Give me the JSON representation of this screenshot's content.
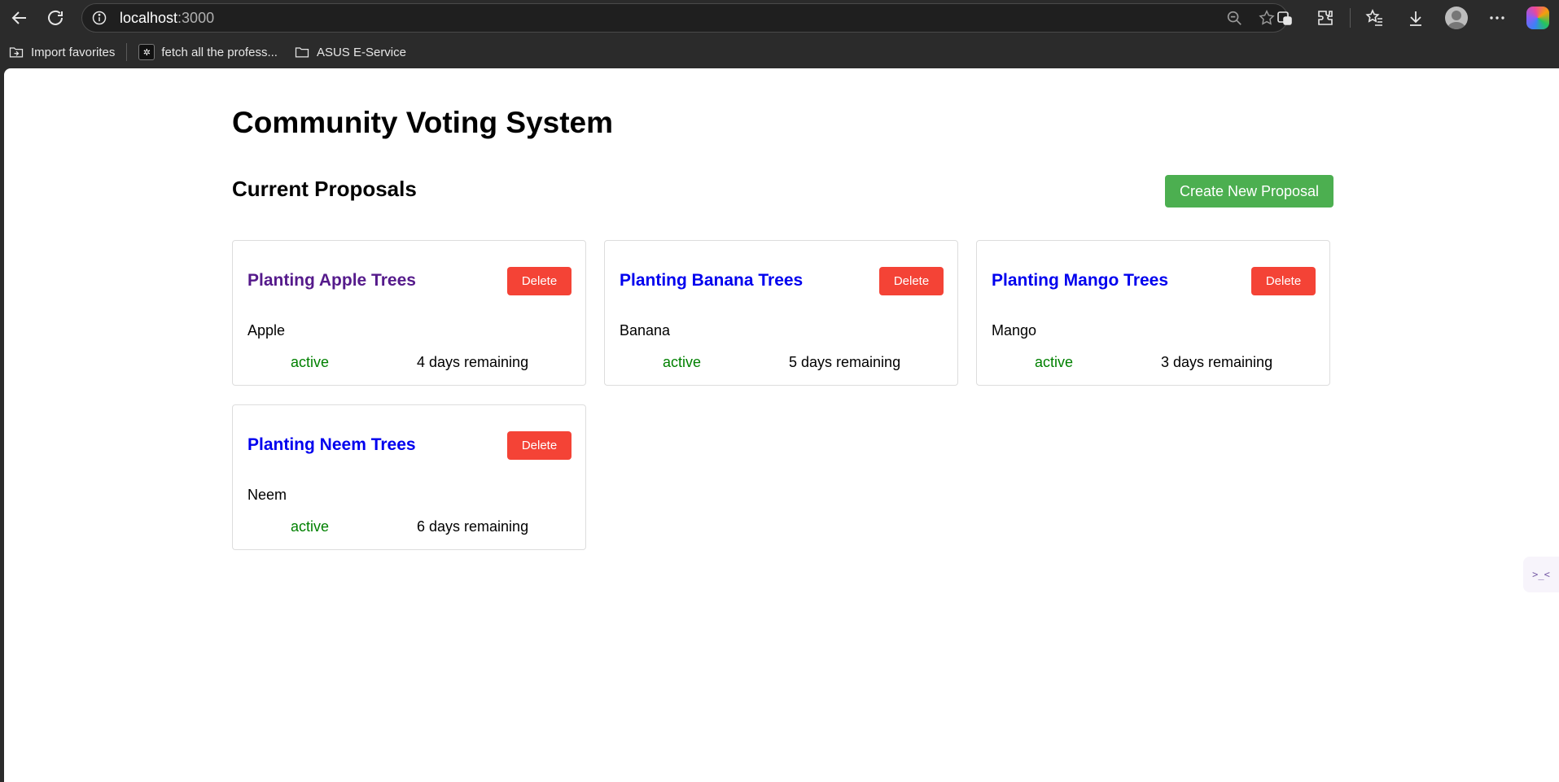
{
  "browser": {
    "url_host": "localhost",
    "url_port": ":3000",
    "bookmarks": [
      {
        "label": "Import favorites",
        "icon": "import-folder-icon"
      },
      {
        "label": "fetch all the profess...",
        "icon": "site-logo-icon"
      },
      {
        "label": "ASUS E-Service",
        "icon": "folder-icon"
      }
    ]
  },
  "page": {
    "title": "Community Voting System",
    "section_title": "Current Proposals",
    "create_button": "Create New Proposal"
  },
  "proposals": [
    {
      "title": "Planting Apple Trees",
      "description": "Apple",
      "status": "active",
      "remaining": "4 days remaining",
      "delete_label": "Delete",
      "visited": true
    },
    {
      "title": "Planting Banana Trees",
      "description": "Banana",
      "status": "active",
      "remaining": "5 days remaining",
      "delete_label": "Delete",
      "visited": false
    },
    {
      "title": "Planting Mango Trees",
      "description": "Mango",
      "status": "active",
      "remaining": "3 days remaining",
      "delete_label": "Delete",
      "visited": false
    },
    {
      "title": "Planting Neem Trees",
      "description": "Neem",
      "status": "active",
      "remaining": "6 days remaining",
      "delete_label": "Delete",
      "visited": false
    }
  ],
  "colors": {
    "create_button": "#4caf50",
    "delete_button": "#f44336",
    "status_active": "#008000",
    "link_title": "#0000ee",
    "visited_title": "#551a8b"
  }
}
